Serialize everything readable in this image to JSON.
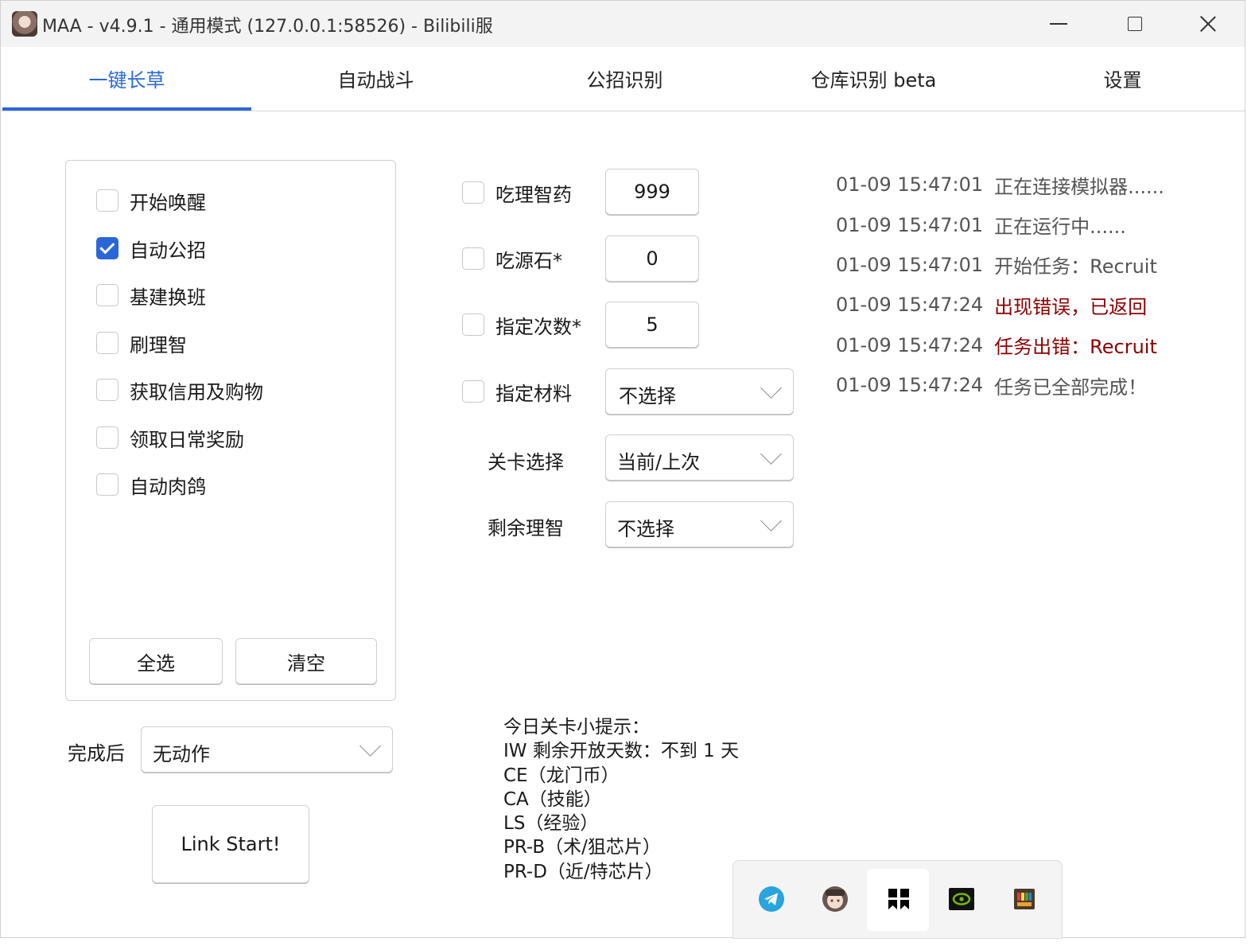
{
  "window": {
    "title": "MAA - v4.9.1 - 通用模式 (127.0.0.1:58526) - Bilibili服"
  },
  "tabs": [
    {
      "label": "一键长草",
      "active": true
    },
    {
      "label": "自动战斗",
      "active": false
    },
    {
      "label": "公招识别",
      "active": false
    },
    {
      "label": "仓库识别 beta",
      "active": false
    },
    {
      "label": "设置",
      "active": false
    }
  ],
  "tasks": [
    {
      "label": "开始唤醒",
      "checked": false
    },
    {
      "label": "自动公招",
      "checked": true
    },
    {
      "label": "基建换班",
      "checked": false
    },
    {
      "label": "刷理智",
      "checked": false
    },
    {
      "label": "获取信用及购物",
      "checked": false
    },
    {
      "label": "领取日常奖励",
      "checked": false
    },
    {
      "label": "自动肉鸽",
      "checked": false
    }
  ],
  "task_buttons": {
    "select_all": "全选",
    "clear": "清空"
  },
  "after_completion": {
    "label": "完成后",
    "value": "无动作"
  },
  "link_start": "Link Start!",
  "options": {
    "use_medicine": {
      "label": "吃理智药",
      "checked": false,
      "value": "999"
    },
    "use_stone": {
      "label": "吃源石*",
      "checked": false,
      "value": "0"
    },
    "times": {
      "label": "指定次数*",
      "checked": false,
      "value": "5"
    },
    "material": {
      "label": "指定材料",
      "checked": false,
      "value": "不选择"
    },
    "stage": {
      "label": "关卡选择",
      "value": "当前/上次"
    },
    "remaining_sanity": {
      "label": "剩余理智",
      "value": "不选择"
    }
  },
  "log": [
    {
      "time": "01-09  15:47:01",
      "message": "正在连接模拟器......",
      "level": "normal"
    },
    {
      "time": "01-09  15:47:01",
      "message": "正在运行中......",
      "level": "normal"
    },
    {
      "time": "01-09  15:47:01",
      "message": "开始任务：Recruit",
      "level": "normal"
    },
    {
      "time": "01-09  15:47:24",
      "message": "出现错误，已返回",
      "level": "error"
    },
    {
      "time": "01-09  15:47:24",
      "message": "任务出错：Recruit",
      "level": "error"
    },
    {
      "time": "01-09  15:47:24",
      "message": "任务已全部完成！",
      "level": "normal"
    }
  ],
  "tips": {
    "title": "今日关卡小提示：",
    "lines": [
      "IW 剩余开放天数：不到 1 天",
      "CE（龙门币）",
      "CA（技能）",
      "LS（经验）",
      "PR-B（术/狙芯片）",
      "PR-D（近/特芯片）"
    ]
  },
  "tray_icons": [
    "telegram-icon",
    "maa-icon",
    "notion-icon",
    "nvidia-icon",
    "color-app-icon"
  ],
  "colors": {
    "accent": "#2b66d9",
    "error": "#8b0000",
    "log_text": "#555555"
  }
}
